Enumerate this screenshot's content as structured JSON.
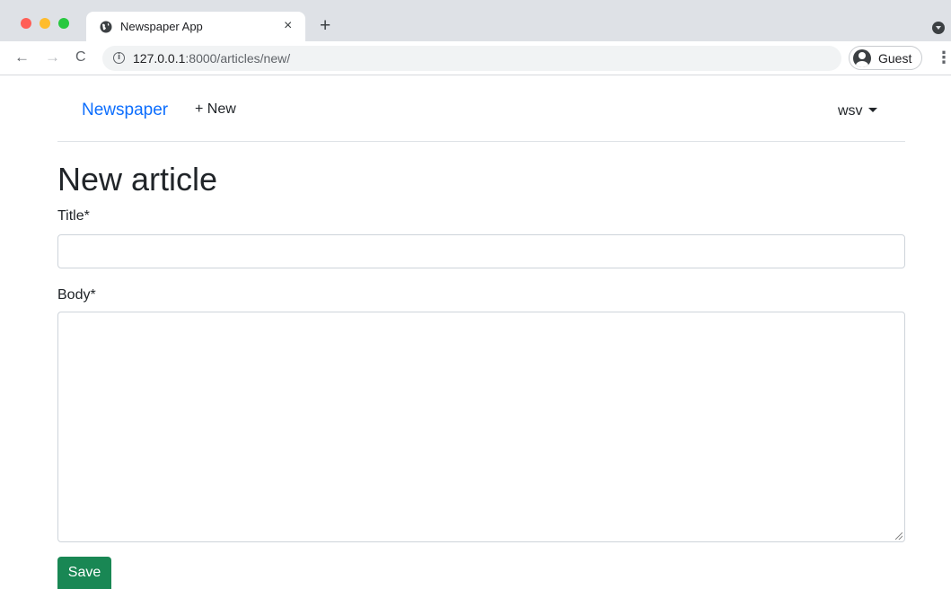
{
  "browser": {
    "tab_title": "Newspaper App",
    "tab_close": "×",
    "new_tab": "+",
    "url_host": "127.0.0.1",
    "url_rest": ":8000/articles/new/",
    "profile_label": "Guest",
    "nav": {
      "back": "←",
      "forward": "→",
      "reload": "C",
      "menu": "⋮",
      "info": "i"
    }
  },
  "navbar": {
    "brand": "Newspaper",
    "new_link": "+ New",
    "user": "wsv"
  },
  "form": {
    "heading": "New article",
    "title_label": "Title*",
    "title_value": "",
    "body_label": "Body*",
    "body_value": "",
    "save_label": "Save"
  },
  "colors": {
    "brand": "#0d6efd",
    "save": "#198754"
  }
}
